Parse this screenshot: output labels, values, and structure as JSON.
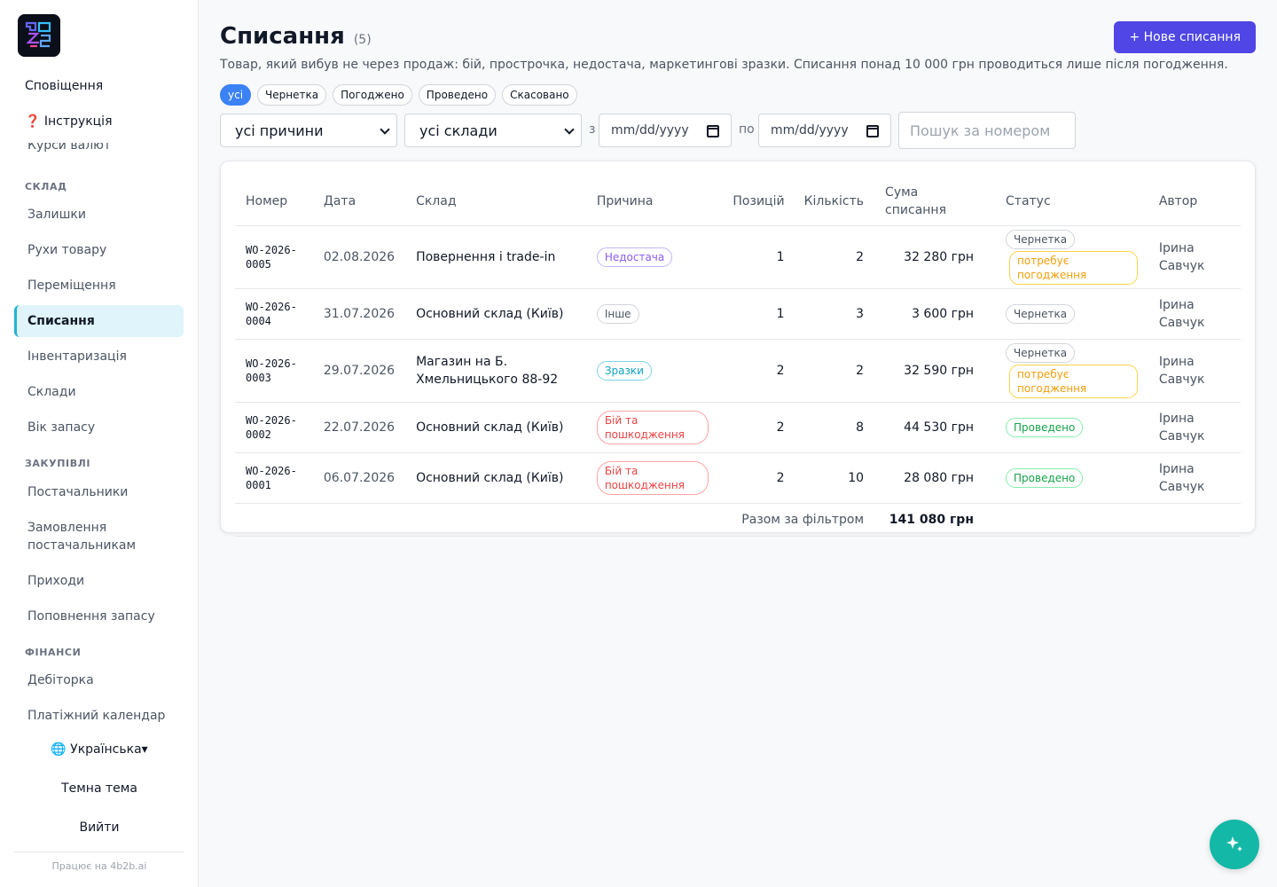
{
  "sidebar": {
    "notifications": "Сповіщення",
    "instructions": "❓ Інструкція",
    "currency": "Курси валют",
    "sections": {
      "warehouse": "СКЛАД",
      "purchasing": "ЗАКУПІВЛІ",
      "finance": "ФІНАНСИ"
    },
    "warehouse_items": [
      "Залишки",
      "Рухи товару",
      "Переміщення",
      "Списання",
      "Інвентаризація",
      "Склади",
      "Вік запасу"
    ],
    "purchasing_items": [
      "Постачальники",
      "Замовлення постачальникам",
      "Приходи",
      "Поповнення запасу"
    ],
    "finance_items": [
      "Дебіторка",
      "Платіжний календар"
    ],
    "language": "🌐 Українська▾",
    "dark_theme": "Темна тема",
    "logout": "Вийти",
    "powered_by": "Працює на 4b2b.ai"
  },
  "page": {
    "title": "Списання",
    "count": "(5)",
    "new_button": "+ Нове списання",
    "subtitle": "Товар, який вибув не через продаж: бій, прострочка, недостача, маркетингові зразки. Списання понад 10 000 грн проводиться лише після погодження."
  },
  "status_filters": [
    "усі",
    "Чернетка",
    "Погоджено",
    "Проведено",
    "Скасовано"
  ],
  "filters": {
    "reason": "усі причини",
    "warehouse": "усі склади",
    "from_label": "з",
    "to_label": "по",
    "date_from": "mm/dd/yyyy",
    "date_to": "mm/dd/yyyy",
    "search_placeholder": "Пошук за номером"
  },
  "table": {
    "headers": {
      "number": "Номер",
      "date": "Дата",
      "warehouse": "Склад",
      "reason": "Причина",
      "positions": "Позицій",
      "quantity": "Кількість",
      "amount": "Сума списання",
      "status": "Статус",
      "author": "Автор"
    },
    "rows": [
      {
        "number": "WO-2026-0005",
        "date": "02.08.2026",
        "warehouse": "Повернення і trade-in",
        "reason": "Недостача",
        "positions": "1",
        "quantity": "2",
        "amount": "32 280 грн",
        "status": "Чернетка",
        "note": "потребує погодження",
        "author": "Ірина Савчук"
      },
      {
        "number": "WO-2026-0004",
        "date": "31.07.2026",
        "warehouse": "Основний склад (Київ)",
        "reason": "Інше",
        "positions": "1",
        "quantity": "3",
        "amount": "3 600 грн",
        "status": "Чернетка",
        "note": "",
        "author": "Ірина Савчук"
      },
      {
        "number": "WO-2026-0003",
        "date": "29.07.2026",
        "warehouse": "Магазин на Б. Хмельницького 88-92",
        "reason": "Зразки",
        "positions": "2",
        "quantity": "2",
        "amount": "32 590 грн",
        "status": "Чернетка",
        "note": "потребує погодження",
        "author": "Ірина Савчук"
      },
      {
        "number": "WO-2026-0002",
        "date": "22.07.2026",
        "warehouse": "Основний склад (Київ)",
        "reason": "Бій та пошкодження",
        "positions": "2",
        "quantity": "8",
        "amount": "44 530 грн",
        "status": "Проведено",
        "note": "",
        "author": "Ірина Савчук"
      },
      {
        "number": "WO-2026-0001",
        "date": "06.07.2026",
        "warehouse": "Основний склад (Київ)",
        "reason": "Бій та пошкодження",
        "positions": "2",
        "quantity": "10",
        "amount": "28 080 грн",
        "status": "Проведено",
        "note": "",
        "author": "Ірина Савчук"
      }
    ],
    "total_label": "Разом за фільтром",
    "total_value": "141 080 грн"
  },
  "colors": {
    "accent": "#4f46e5",
    "chip_active": "#3b82f6",
    "sidebar_active_bg": "#dff4fb",
    "fab": "#14b8a6"
  },
  "icons": {
    "logo": "4b2b-logo",
    "calendar": "calendar-icon",
    "fab": "sparkles-icon"
  }
}
